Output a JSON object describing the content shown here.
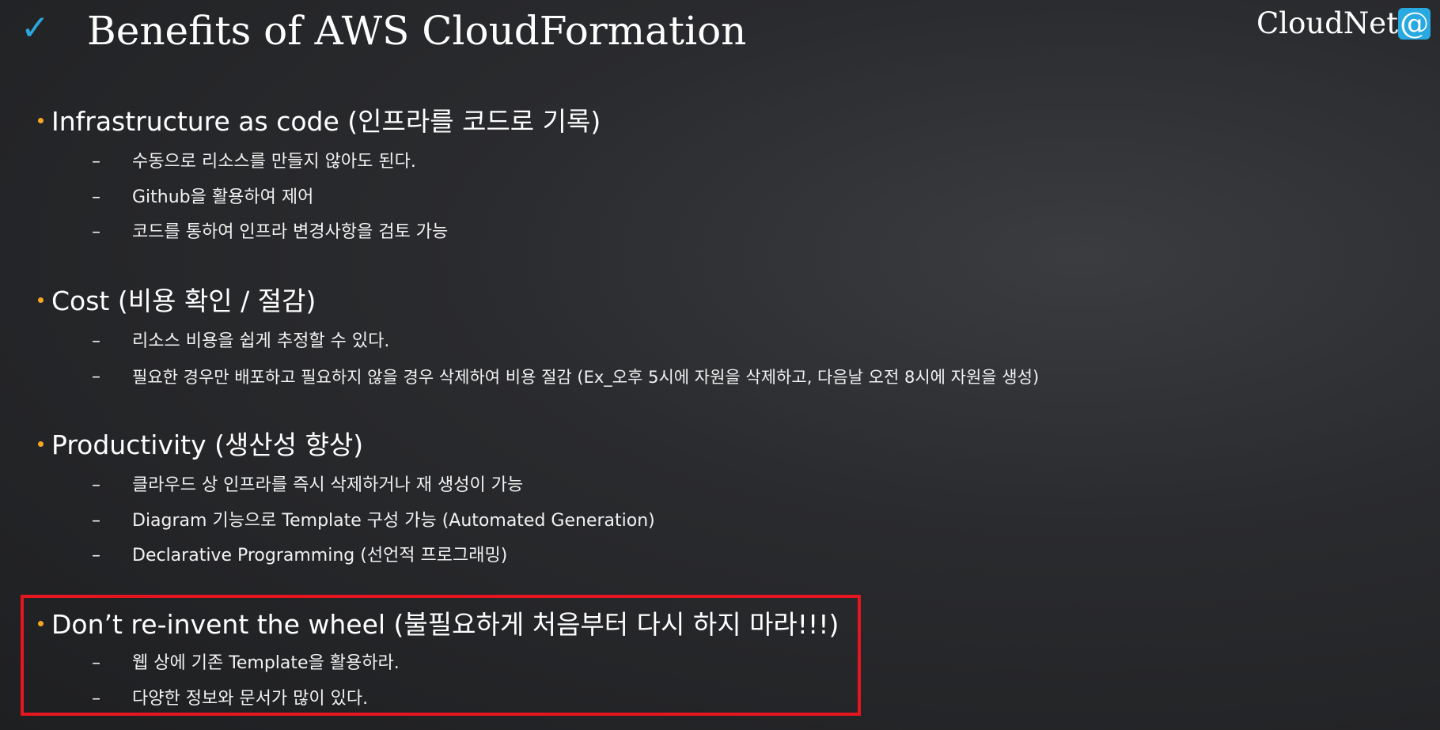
{
  "slide": {
    "check_icon": "✓",
    "title": "Benefits of AWS CloudFormation",
    "brand_text": "CloudNet",
    "brand_at": "@",
    "accent_color": "#2aa7de",
    "bullet_color": "#f5a623",
    "highlight_color": "#e5161f"
  },
  "sections": [
    {
      "heading": "Infrastructure as code (인프라를 코드로 기록)",
      "items": [
        "수동으로 리소스를 만들지 않아도 된다.",
        "Github을 활용하여 제어",
        "코드를 통하여 인프라 변경사항을 검토 가능"
      ]
    },
    {
      "heading": "Cost (비용 확인 / 절감)",
      "items": [
        "리소스 비용을 쉽게 추정할 수 있다.",
        "필요한 경우만 배포하고 필요하지 않을 경우 삭제하여 비용 절감 (Ex_오후 5시에 자원을 삭제하고, 다음날 오전 8시에 자원을 생성)"
      ]
    },
    {
      "heading": "Productivity (생산성 향상)",
      "items": [
        "클라우드 상 인프라를 즉시 삭제하거나 재 생성이 가능",
        "Diagram 기능으로 Template 구성 가능 (Automated Generation)",
        "Declarative Programming (선언적 프로그래밍)"
      ]
    },
    {
      "heading": "Don’t re-invent the wheel (불필요하게 처음부터 다시 하지 마라!!!)",
      "items": [
        "웹 상에 기존 Template을 활용하라.",
        "다양한 정보와 문서가 많이 있다."
      ]
    }
  ],
  "dash": "–"
}
